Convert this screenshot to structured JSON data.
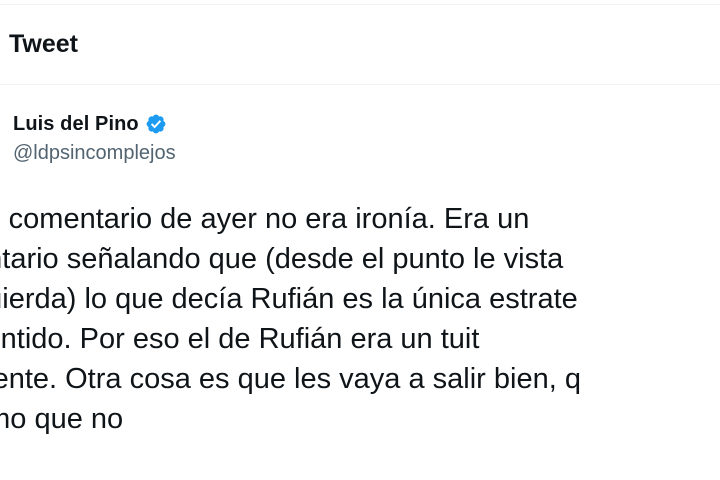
{
  "header": {
    "title": "Tweet"
  },
  "author": {
    "name": "Luis del Pino",
    "handle": "@ldpsincomplejos",
    "verified": true,
    "badge_color": "#1d9bf0"
  },
  "tweet": {
    "lines": [
      "mi comentario de ayer no era ironía. Era un",
      "entario señalando que (desde el punto le vista",
      "quierda) lo que decía Rufián es la única estrate",
      "sentido. Por eso el de Rufián era un tuit",
      "igente. Otra cosa es que les vaya a salir bien, q",
      "emo que no"
    ]
  },
  "colors": {
    "text": "#0f1419",
    "secondary_text": "#536471",
    "divider": "#eff3f4",
    "background": "#ffffff"
  }
}
